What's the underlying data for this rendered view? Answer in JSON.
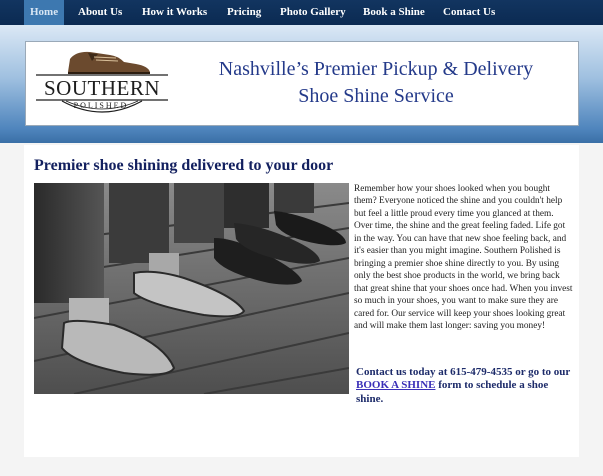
{
  "nav": {
    "items": [
      {
        "label": "Home",
        "active": true
      },
      {
        "label": "About Us"
      },
      {
        "label": "How it Works"
      },
      {
        "label": "Pricing"
      },
      {
        "label": "Photo Gallery"
      },
      {
        "label": "Book a Shine"
      },
      {
        "label": "Contact Us"
      }
    ]
  },
  "banner": {
    "logo_name": "SOUTHERN",
    "logo_sub": "POLISHED",
    "line1": "Nashville’s Premier Pickup & Delivery",
    "line2": "Shoe Shine Service"
  },
  "main": {
    "heading": "Premier shoe shining delivered to your door",
    "paragraph": "Remember how your shoes looked when you bought them? Everyone noticed the shine and you couldn't help but feel a little proud every time you glanced at them. Over time, the shine and the great feeling faded. Life got in the way. You can have that new shoe feeling back, and it's easier than you might imagine. Southern Polished is bringing a premier shoe shine directly to you. By using only the best shoe products in the world, we bring back that great shine that your shoes once had. When you invest so much in your shoes, you want to make sure they are cared for. Our service will keep your shoes looking great and will make them last longer: saving you money!",
    "contact_before": "Contact us today at 615-479-4535 or go to our ",
    "contact_link": "BOOK A SHINE",
    "contact_after": " form to schedule a shoe shine."
  },
  "colors": {
    "nav_bg": "#0b2a52",
    "nav_active": "#3d78b0",
    "banner_text": "#243a8a",
    "heading": "#13205f",
    "link": "#3a2fb8"
  }
}
